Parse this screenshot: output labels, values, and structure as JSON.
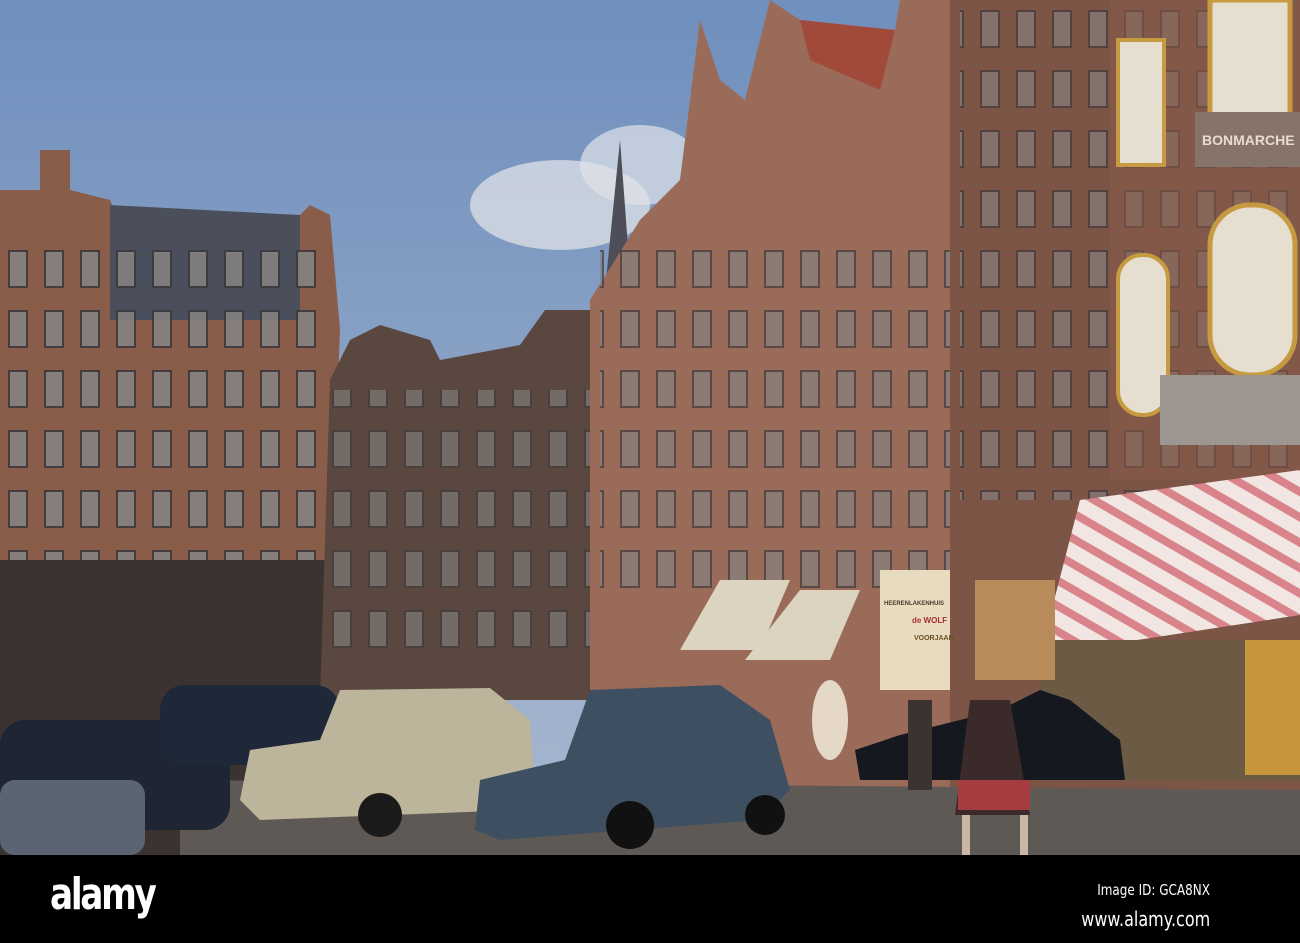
{
  "footer": {
    "logo": "alamy",
    "image_id": "Image ID: GCA8NX",
    "website": "www.alamy.com"
  },
  "scene": {
    "shop_signs": [
      "HEERENLAKENHUIS",
      "de WOLF",
      "VOORJAAR",
      "BONMARCHE"
    ],
    "colors": {
      "sky": "#8aa4c8",
      "brick": "#8a5a48",
      "awning_stripe": "#d9848a",
      "awning_base": "#f1e6e2",
      "car_beige": "#bdb49c",
      "car_blue": "#3e4f62"
    }
  }
}
